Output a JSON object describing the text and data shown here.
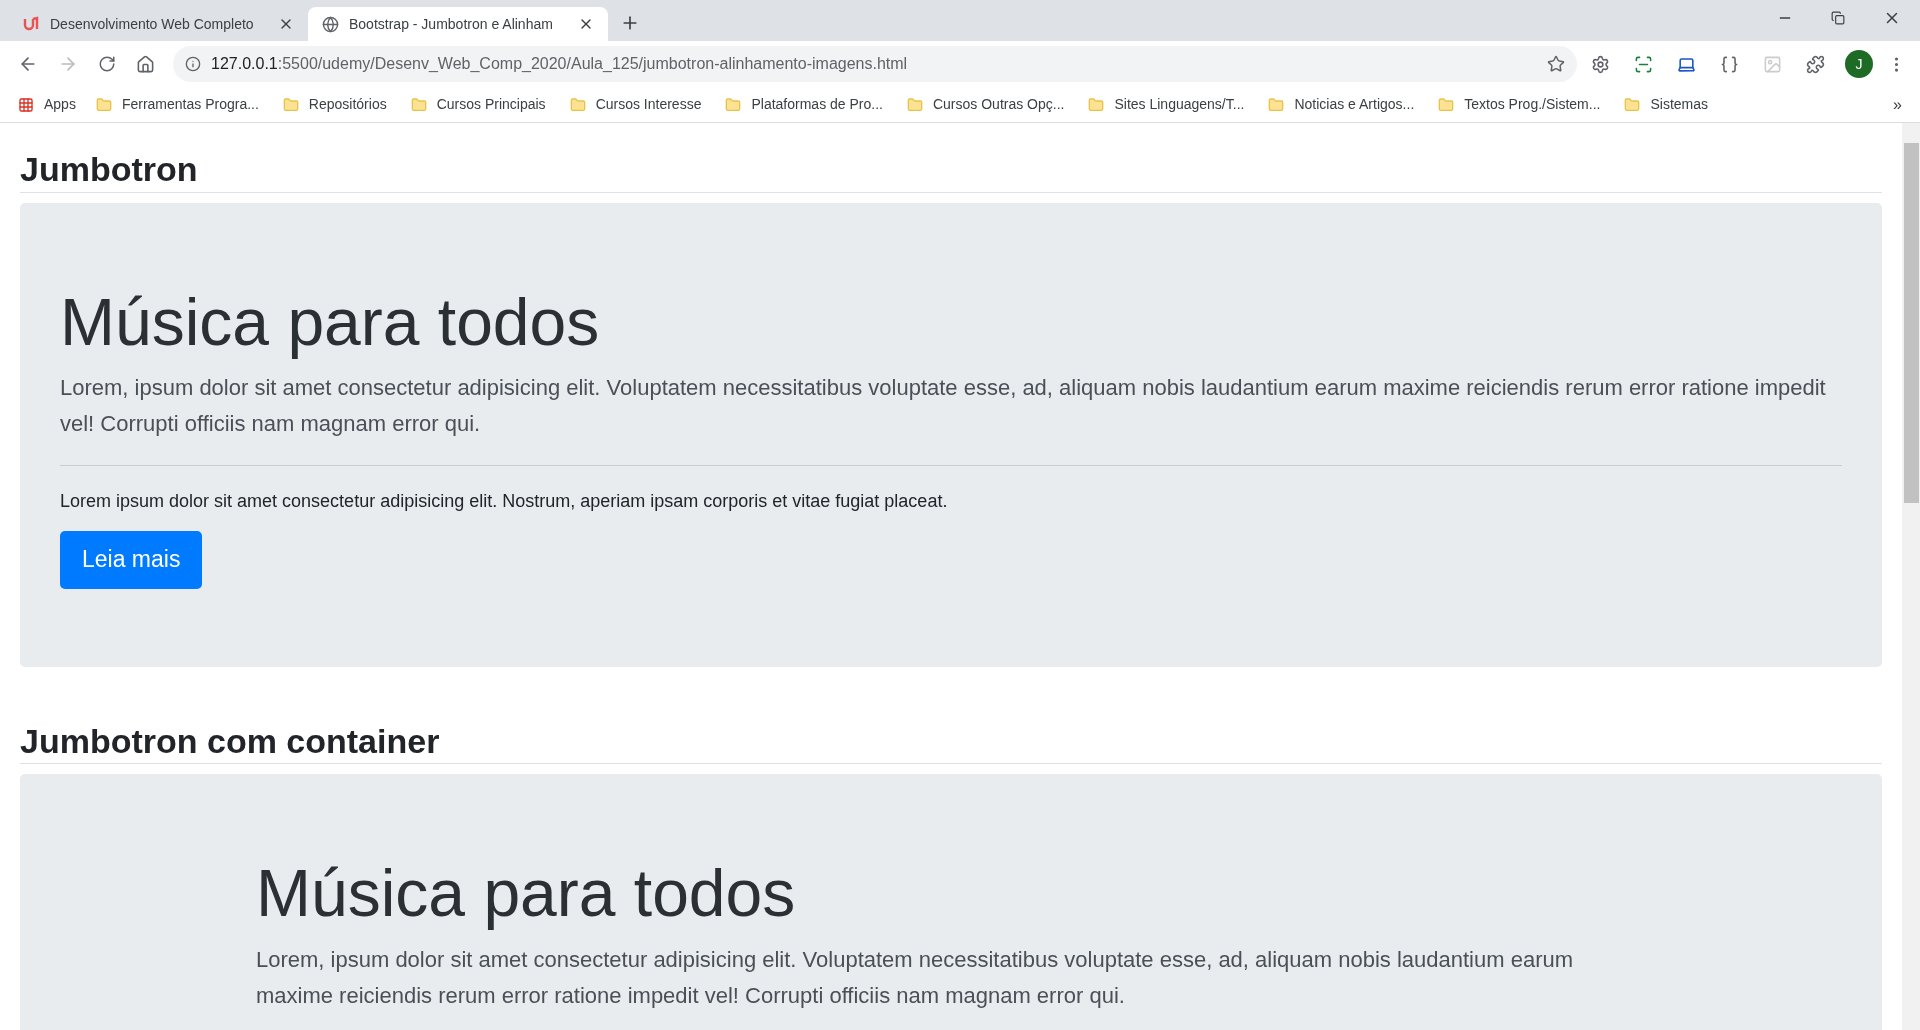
{
  "browser": {
    "tabs": [
      {
        "title": "Desenvolvimento Web Completo",
        "selected": false,
        "kind": "udemy"
      },
      {
        "title": "Bootstrap - Jumbotron e Alinham",
        "selected": true,
        "kind": "globe"
      }
    ],
    "url_host": "127.0.0.1",
    "url_rest": ":5500/udemy/Desenv_Web_Comp_2020/Aula_125/jumbotron-alinhamento-imagens.html",
    "profile": "J",
    "bookmarks": [
      {
        "label": "Apps",
        "kind": "apps"
      },
      {
        "label": "Ferramentas Progra...",
        "kind": "folder"
      },
      {
        "label": "Repositórios",
        "kind": "folder"
      },
      {
        "label": "Cursos Principais",
        "kind": "folder"
      },
      {
        "label": "Cursos Interesse",
        "kind": "folder"
      },
      {
        "label": "Plataformas de Pro...",
        "kind": "folder"
      },
      {
        "label": "Cursos Outras Opç...",
        "kind": "folder"
      },
      {
        "label": "Sites Linguagens/T...",
        "kind": "folder"
      },
      {
        "label": "Noticias e Artigos...",
        "kind": "folder"
      },
      {
        "label": "Textos Prog./Sistem...",
        "kind": "folder"
      },
      {
        "label": "Sistemas",
        "kind": "folder"
      }
    ],
    "more": "»"
  },
  "sections": [
    {
      "heading": "Jumbotron",
      "container": false,
      "display": "Música para todos",
      "lead": "Lorem, ipsum dolor sit amet consectetur adipisicing elit. Voluptatem necessitatibus voluptate esse, ad, aliquam nobis laudantium earum maxime reiciendis rerum error ratione impedit vel! Corrupti officiis nam magnam error qui.",
      "text": "Lorem ipsum dolor sit amet consectetur adipisicing elit. Nostrum, aperiam ipsam corporis et vitae fugiat placeat.",
      "button": "Leia mais"
    },
    {
      "heading": "Jumbotron com container",
      "container": true,
      "display": "Música para todos",
      "lead": "Lorem, ipsum dolor sit amet consectetur adipisicing elit. Voluptatem necessitatibus voluptate esse, ad, aliquam nobis laudantium earum maxime reiciendis rerum error ratione impedit vel! Corrupti officiis nam magnam error qui."
    }
  ]
}
